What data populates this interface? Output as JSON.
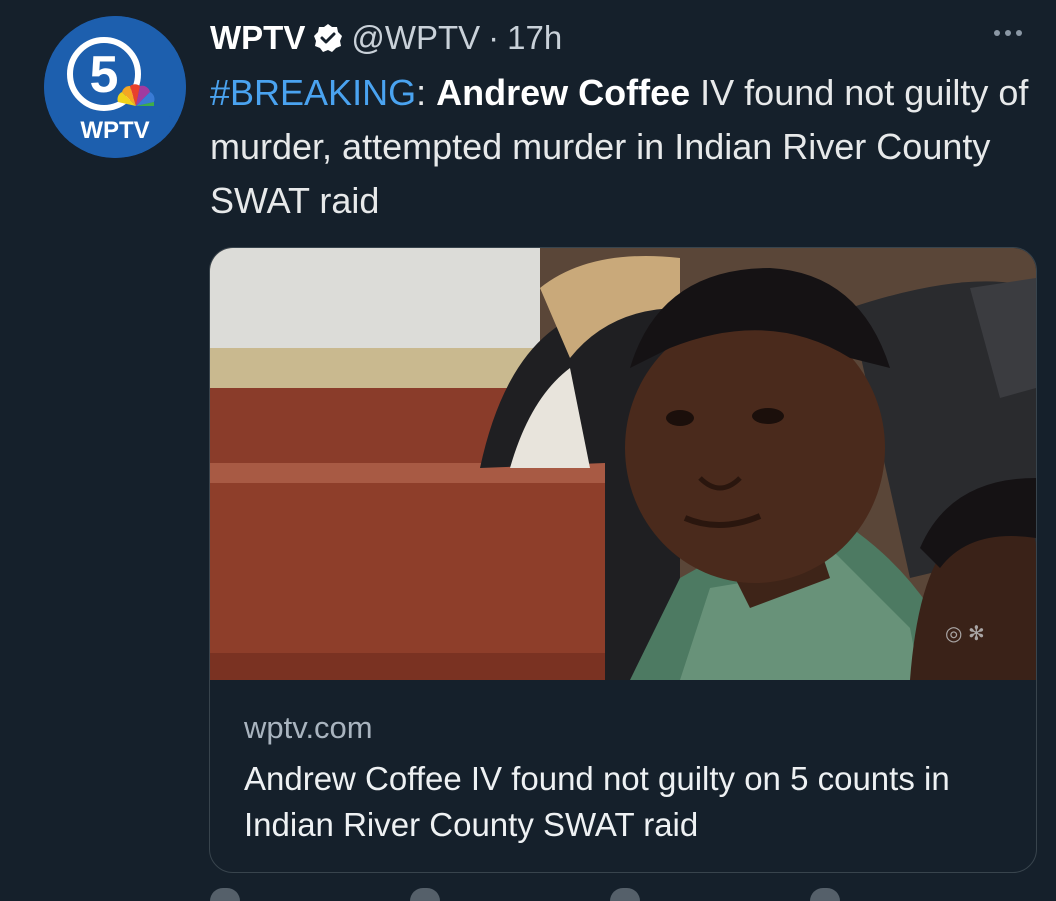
{
  "account": {
    "name": "WPTV",
    "handle": "@WPTV",
    "separator": "·",
    "time": "17h",
    "avatar_channel_number": "5",
    "avatar_logo_text": "WPTV"
  },
  "tweet": {
    "hashtag": "#BREAKING",
    "colon": ":",
    "bold_name": "Andrew Coffee",
    "rest": "IV found not guilty of murder, attempted murder in Indian River County SWAT raid"
  },
  "link_card": {
    "domain": "wptv.com",
    "title": "Andrew Coffee IV found not guilty on 5 counts in Indian River County SWAT raid"
  },
  "icons": {
    "verified": "verified-badge-icon",
    "more": "more-options-icon"
  },
  "colors": {
    "background": "#15202b",
    "link_blue": "#4aa3f0",
    "avatar_blue": "#1b5aa8"
  }
}
